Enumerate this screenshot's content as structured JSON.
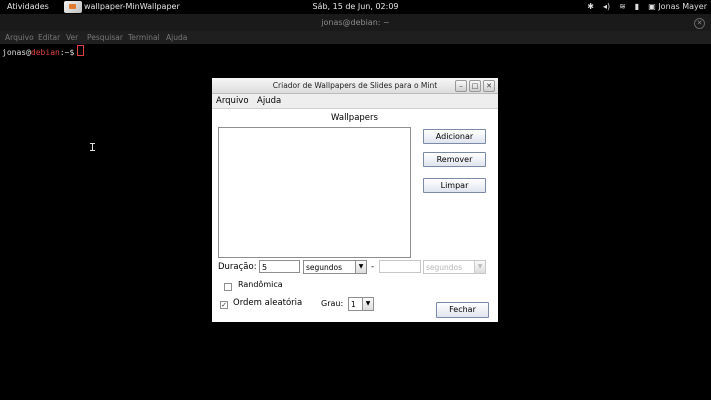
{
  "topbar": {
    "activities": "Atividades",
    "app_title": "wallpaper-MinWallpaper",
    "clock": "Sáb, 15 de Jun, 02:09",
    "user": "Jonas Mayer"
  },
  "terminal": {
    "title": "jonas@debian: ~",
    "menu": [
      "Arquivo",
      "Editar",
      "Ver",
      "Pesquisar",
      "Terminal",
      "Ajuda"
    ],
    "prompt_user": "jonas",
    "prompt_at": "@",
    "prompt_host": "debian",
    "prompt_path": ":~$"
  },
  "dialog": {
    "title": "Criador de Wallpapers de Slides para o Mint",
    "menu": [
      "Arquivo",
      "Ajuda"
    ],
    "list_label": "Wallpapers",
    "buttons": {
      "add": "Adicionar",
      "remove": "Remover",
      "clear": "Limpar",
      "close": "Fechar"
    },
    "duration_label": "Duração:",
    "duration_value": "5",
    "duration_unit": "segundos",
    "dash": "-",
    "transition_value": "",
    "transition_unit": "segundos",
    "random_label": "Randômica",
    "random_checked": false,
    "order_label": "Ordem aleatória",
    "order_checked": true,
    "grau_label": "Grau:",
    "grau_value": "1"
  }
}
